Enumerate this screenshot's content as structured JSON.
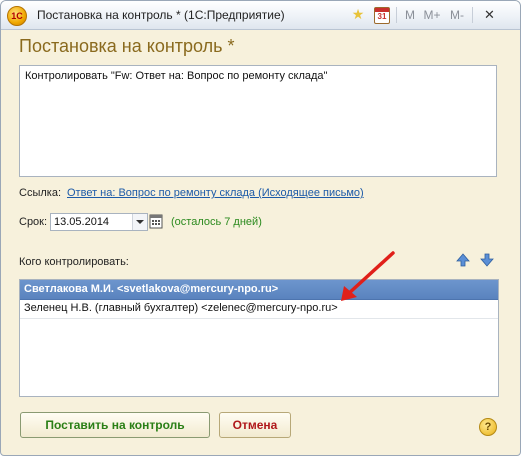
{
  "window": {
    "title": "Постановка на контроль * (1С:Предприятие)",
    "app_icon": "1С",
    "toolbar": {
      "favorite_icon": "star-icon",
      "calendar_day": "31",
      "m_label": "M",
      "m_plus_label": "M+",
      "m_minus_label": "M-",
      "close_icon": "close-icon"
    }
  },
  "form": {
    "title": "Постановка на контроль *",
    "subject": "Контролировать \"Fw: Ответ на: Вопрос по ремонту склада\"",
    "link_label": "Ссылка:",
    "link_text": "Ответ на: Вопрос по ремонту склада (Исходящее письмо)",
    "due_label": "Срок:",
    "due_date": "13.05.2014",
    "remaining": "(осталось 7 дней)",
    "who_label": "Кого контролировать:",
    "people": [
      {
        "text": "Светлакова М.И. <svetlakova@mercury-npo.ru>",
        "selected": true
      },
      {
        "text": "Зеленец Н.В. (главный бухгалтер) <zelenec@mercury-npo.ru>",
        "selected": false
      }
    ]
  },
  "buttons": {
    "submit": "Поставить на контроль",
    "cancel": "Отмена",
    "help": "?"
  },
  "colors": {
    "title": "#8a6a1e",
    "selected_row": "#6d95cd",
    "remaining": "#2b8a1e",
    "submit_text": "#2a7f16",
    "cancel_text": "#b0181b",
    "annotation_arrow": "#e0201a"
  }
}
